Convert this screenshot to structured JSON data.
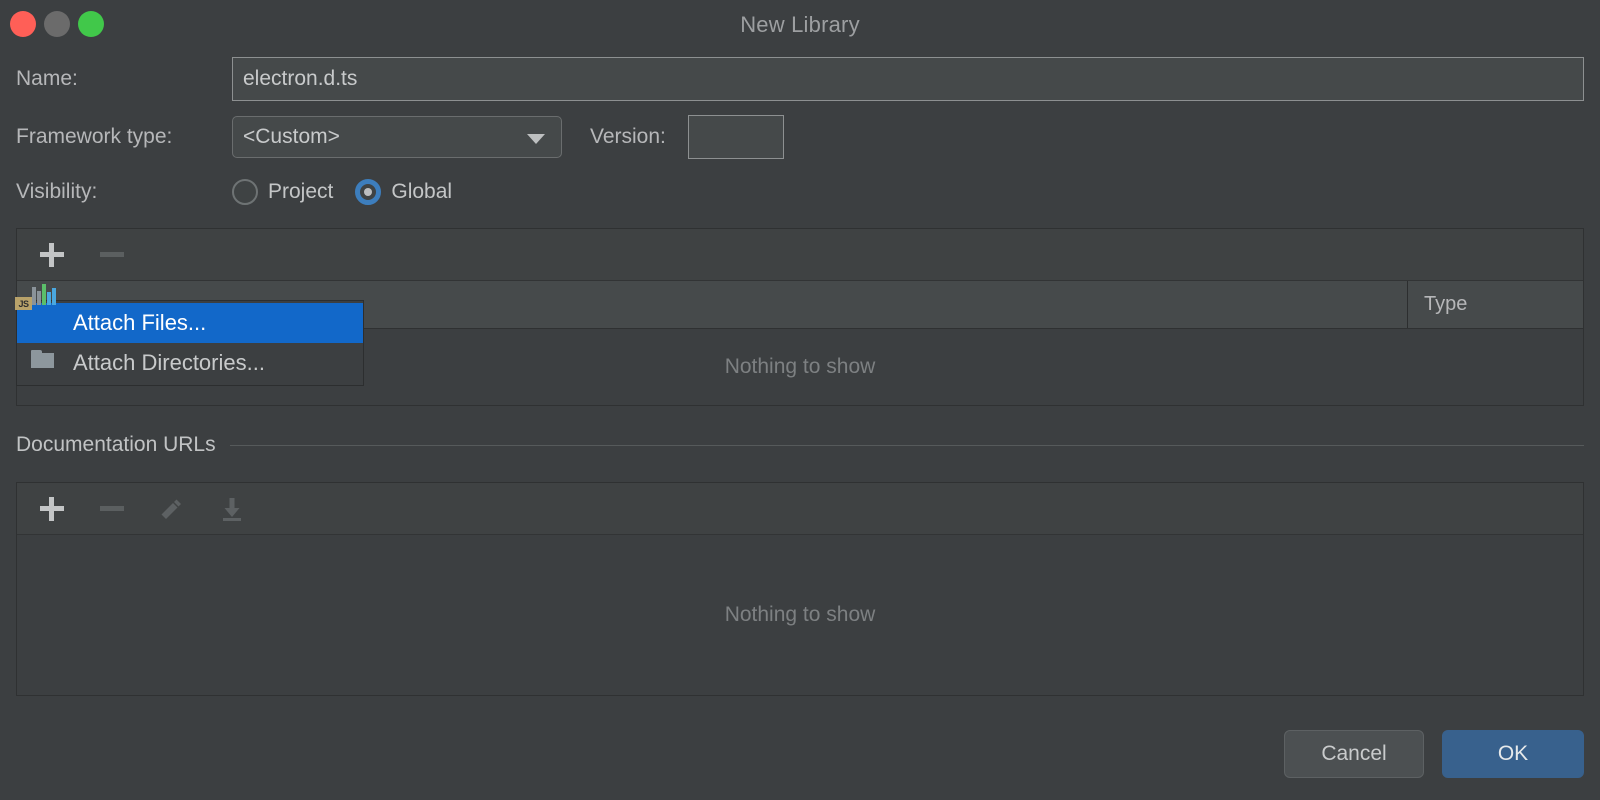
{
  "window": {
    "title": "New Library",
    "traffic_lights": [
      "close-button",
      "minimize-button",
      "zoom-button"
    ]
  },
  "form": {
    "name_label": "Name:",
    "name_value": "electron.d.ts",
    "framework_label": "Framework type:",
    "framework_value": "<Custom>",
    "version_label": "Version:",
    "version_value": "",
    "visibility_label": "Visibility:",
    "visibility_options": [
      {
        "label": "Project",
        "selected": false
      },
      {
        "label": "Global",
        "selected": true
      }
    ]
  },
  "classes_panel": {
    "toolbar": {
      "add_label": "+",
      "remove_label": "−"
    },
    "columns": [
      "",
      "Type"
    ],
    "empty_text": "Nothing to show"
  },
  "docs_panel": {
    "section_label": "Documentation URLs",
    "toolbar": {
      "add_label": "+",
      "remove_label": "−",
      "edit_label": "edit",
      "download_label": "download"
    },
    "empty_text": "Nothing to show"
  },
  "context_menu": {
    "items": [
      {
        "label": "Attach Files...",
        "icon": "js-library-icon",
        "selected": true
      },
      {
        "label": "Attach Directories...",
        "icon": "folder-icon",
        "selected": false
      }
    ]
  },
  "footer": {
    "cancel_label": "Cancel",
    "ok_label": "OK"
  },
  "colors": {
    "dialog_bg": "#3c3f41",
    "accent_blue": "#1268c9",
    "ok_button": "#38618d",
    "radio_blue": "#3d7ebd",
    "close_red": "#ff5f57",
    "zoom_green": "#41c84a",
    "minimize_gray": "#6b6b6b"
  }
}
